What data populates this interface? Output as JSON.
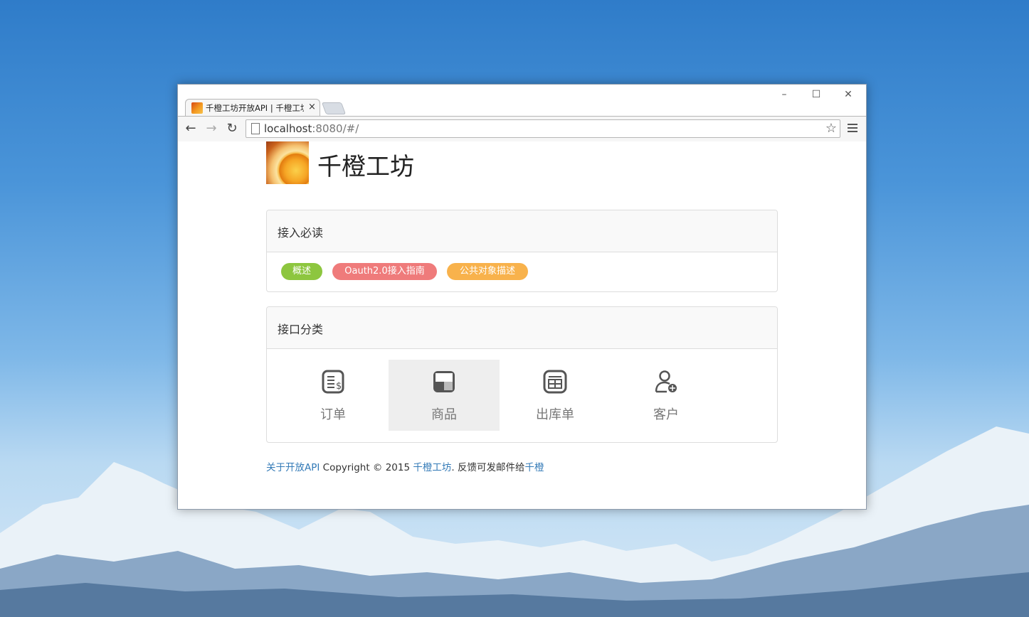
{
  "browser": {
    "tab_title": "千橙工坊开放API | 千橙工坊",
    "tab_close": "×",
    "url_host": "localhost",
    "url_rest": ":8080/#/",
    "minimize": "–",
    "maximize": "☐",
    "close": "✕"
  },
  "header": {
    "brand": "千橙工坊"
  },
  "guide": {
    "title": "接入必读",
    "badges": [
      {
        "label": "概述",
        "color": "#8dc63f"
      },
      {
        "label": "Oauth2.0接入指南",
        "color": "#ef7b7b"
      },
      {
        "label": "公共对象描述",
        "color": "#f8b24c"
      }
    ]
  },
  "categories": {
    "title": "接口分类",
    "items": [
      {
        "label": "订单",
        "icon": "order-icon"
      },
      {
        "label": "商品",
        "icon": "product-icon"
      },
      {
        "label": "出库单",
        "icon": "stockout-icon"
      },
      {
        "label": "客户",
        "icon": "customer-icon"
      }
    ]
  },
  "footer": {
    "about": "关于开放API",
    "copyright": " Copyright © 2015 ",
    "company": "千橙工坊",
    "feedback_prefix": ".   反馈可发邮件给",
    "feedback_link": "千橙"
  }
}
